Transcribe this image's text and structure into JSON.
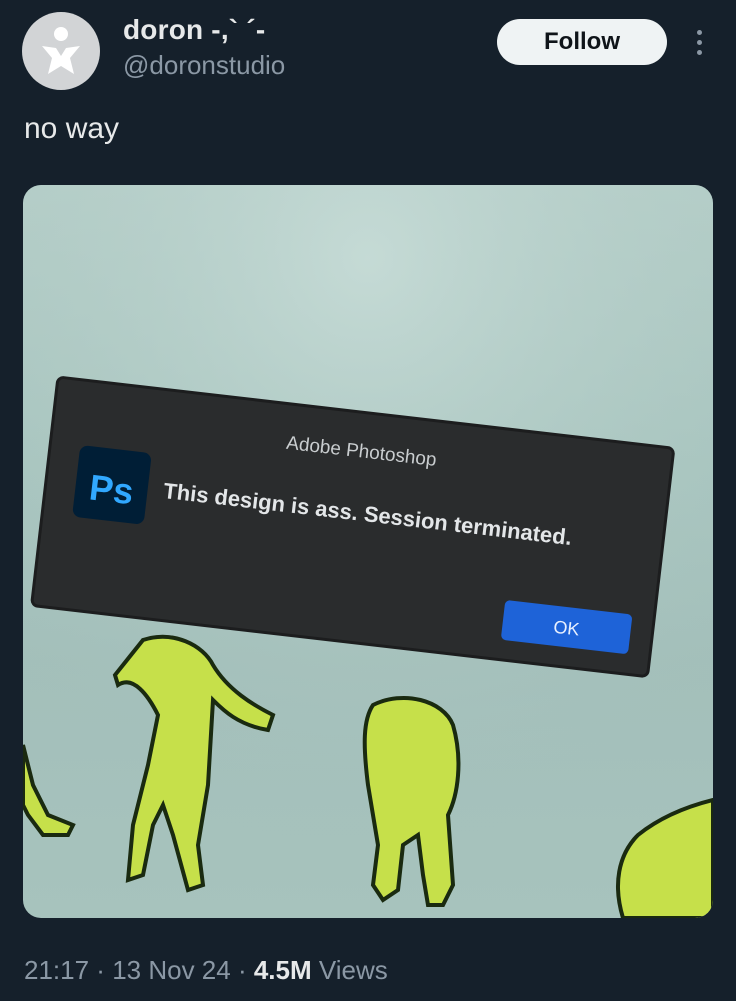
{
  "author": {
    "name": "doron -,` ´-",
    "handle": "@doronstudio"
  },
  "follow_label": "Follow",
  "tweet_text": "no way",
  "media": {
    "dialog_title": "Adobe Photoshop",
    "app_icon_text": "Ps",
    "dialog_message": "This design is ass. Session terminated.",
    "ok_label": "OK"
  },
  "meta": {
    "time": "21:17",
    "sep1": " · ",
    "date": "13 Nov 24",
    "sep2": " · ",
    "views_count": "4.5M",
    "views_label": " Views"
  },
  "colors": {
    "background": "#15202b",
    "follow_bg": "#eff3f4",
    "secondary_text": "#8b98a5",
    "ok_button": "#1e63d8"
  }
}
